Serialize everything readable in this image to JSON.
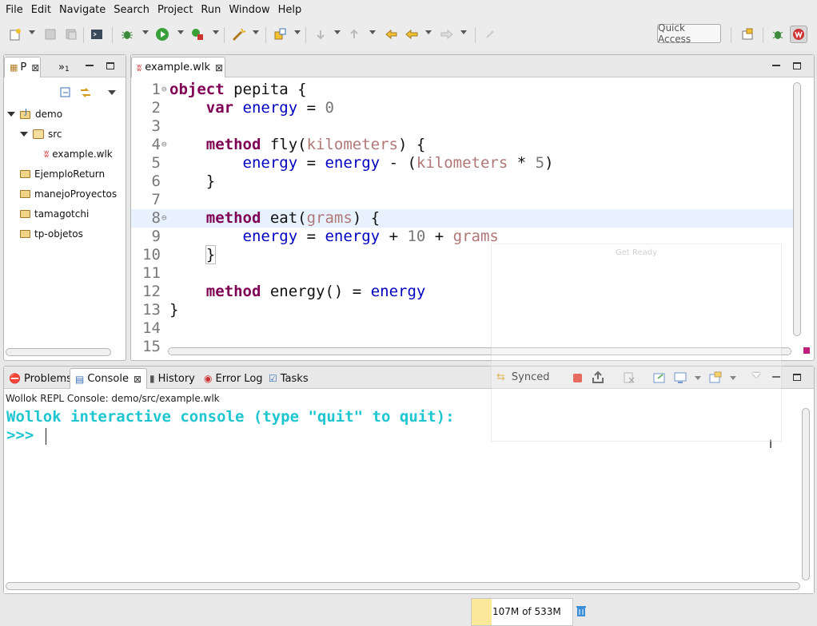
{
  "menu": [
    "File",
    "Edit",
    "Navigate",
    "Search",
    "Project",
    "Run",
    "Window",
    "Help"
  ],
  "toolbar": {
    "quick_access": "Quick Access"
  },
  "explorer": {
    "tab_label": "P",
    "second_tab_label": "»",
    "second_tab_count": "1",
    "tree": [
      {
        "label": "demo"
      },
      {
        "label": "src"
      },
      {
        "label": "example.wlk"
      },
      {
        "label": "EjemploReturn"
      },
      {
        "label": "manejoProyectos"
      },
      {
        "label": "tamagotchi"
      },
      {
        "label": "tp-objetos"
      }
    ]
  },
  "editor": {
    "tab_label": "example.wlk",
    "lines": [
      "1",
      "2",
      "3",
      "4",
      "5",
      "6",
      "7",
      "8",
      "9",
      "10",
      "11",
      "12",
      "13",
      "14",
      "15"
    ],
    "tokens": {
      "object": "object",
      "pepita": " pepita {",
      "var": "var",
      "energy": "energy",
      "eq0": " = ",
      "zero": "0",
      "method": "method",
      "fly": " fly(",
      "kilometers": "kilometers",
      "close_brace_open": ") {",
      "assign": " = ",
      "minus_open": " - (",
      "times5": " * ",
      "five": "5",
      "close_paren": ")",
      "close_brace": "}",
      "eat": " eat(",
      "grams": "grams",
      "plus": " + ",
      "ten": "10",
      "energy_method": " energy() = "
    }
  },
  "ghost_title": "Get Ready",
  "console_view": {
    "tabs": [
      "Problems",
      "Console",
      "History",
      "Error Log",
      "Tasks"
    ],
    "synced": "Synced",
    "title": "Wollok REPL Console: demo/src/example.wlk",
    "banner": "Wollok interactive console (type \"quit\" to quit):",
    "prompt": ">>>"
  },
  "status": {
    "heap": "107M of 533M",
    "heap_fraction": 0.2
  },
  "colors": {
    "keyword": "#7f0055",
    "field": "#0000c0",
    "param": "#b07777",
    "console_text": "#1ec6d0"
  }
}
